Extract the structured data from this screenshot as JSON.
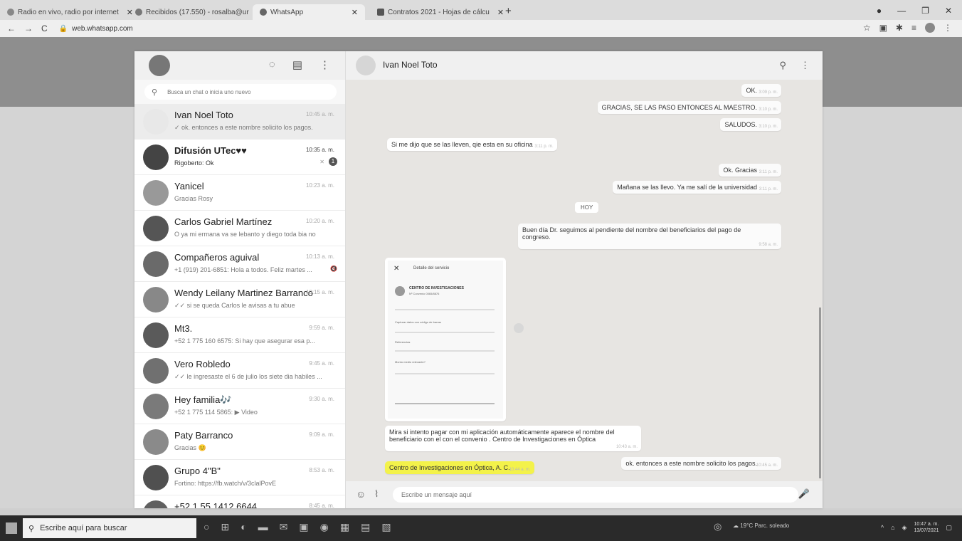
{
  "browser": {
    "tabs": [
      {
        "label": "Radio en vivo, radio por internet",
        "fav": "#888"
      },
      {
        "label": "Recibidos (17.550) - rosalba@ur",
        "fav": "#777"
      },
      {
        "label": "WhatsApp",
        "fav": "#666"
      },
      {
        "label": "Contratos 2021 - Hojas de cálcu",
        "fav": "#555"
      }
    ],
    "url": "web.whatsapp.com"
  },
  "sidebar": {
    "search_placeholder": "Busca un chat o inicia uno nuevo",
    "chats": [
      {
        "name": "Ivan Noel Toto",
        "message": "✓ ok. entonces a este nombre solicito los pagos.",
        "time": "10:45 a. m."
      },
      {
        "name": "Difusión UTec♥♥",
        "message": "Rigoberto: Ok",
        "time": "10:35 a. m.",
        "badge": "1"
      },
      {
        "name": "Yanicel",
        "message": "Gracias Rosy",
        "time": "10:23 a. m."
      },
      {
        "name": "Carlos Gabriel Martínez",
        "message": "O ya mi ermana va se lebanto y diego toda bia no",
        "time": "10:20 a. m."
      },
      {
        "name": "Compañeros aguival",
        "message": "+1 (919) 201-6851: Hola a todos. Feliz martes ...",
        "time": "10:13 a. m."
      },
      {
        "name": "Wendy Leilany Martinez Barranco",
        "message": "✓✓ si se queda Carlos le avisas a tu abue",
        "time": "10:15 a. m."
      },
      {
        "name": "Mt3.",
        "message": "+52 1 775 160 6575: Si hay que asegurar esa p...",
        "time": "9:59 a. m."
      },
      {
        "name": "Vero Robledo",
        "message": "✓✓ le ingresaste el 6 de julio los siete dia habiles ...",
        "time": "9:45 a. m."
      },
      {
        "name": "Hey familia🎶",
        "message": "+52 1 775 114 5865: ▶ Video",
        "time": "9:30 a. m."
      },
      {
        "name": "Paty Barranco",
        "message": "Gracias 😊",
        "time": "9:09 a. m."
      },
      {
        "name": "Grupo 4\"B\"",
        "message": "Fortino: https://fb.watch/v/3clalPovE",
        "time": "8:53 a. m."
      },
      {
        "name": "+52 1 55 1412 6644",
        "message": "",
        "time": "8:45 a. m."
      }
    ]
  },
  "conversation": {
    "contact": "Ivan Noel Toto",
    "messages": {
      "m1": "OK.",
      "m2": "GRACIAS, SE LAS PASO ENTONCES AL MAESTRO.",
      "m3": "SALUDOS.",
      "m4": "Si me dijo que se las lleven, qie esta en su oficina",
      "m5": "Ok. Gracias",
      "m6": "Mañana se las llevo. Ya me salí de la universidad",
      "m7": "Buen día Dr. seguimos al pendiente del nombre del beneficiarios del pago de congreso.",
      "m8": "Mira si intento pagar con mi aplicación automáticamente aparece el nombre del beneficiario con el con el convenio . Centro de Investigaciones en Óptica",
      "m9": "Centro de Investigaciones en Óptica, A. C.",
      "m10": "ok. entonces a este nombre solicito los pagos."
    },
    "times": {
      "m1": "3:09 p. m.",
      "m2": "3:10 p. m.",
      "m3": "3:10 p. m.",
      "m4": "3:11 p. m.",
      "m5": "3:11 p. m.",
      "m6": "3:11 p. m.",
      "m7": "9:58 a. m.",
      "m8": "10:43 a. m.",
      "m9": "10:44 a. m.",
      "m10": "10:45 a. m."
    },
    "day_separator": "HOY",
    "image_card": {
      "title": "Detalle del servicio",
      "org": "CENTRO DE INVESTIGACIONES",
      "convenio": "Nº Convenio 0065/8876",
      "barcode": "Capturar datos con código de barras",
      "ref": "Referencias",
      "method": "Monto medio relevante?"
    },
    "composer_placeholder": "Escribe un mensaje aquí"
  },
  "taskbar": {
    "search": "Escribe aquí para buscar",
    "weather": "19°C Parc. soleado",
    "time": "10:47 a. m.",
    "date": "13/07/2021"
  }
}
